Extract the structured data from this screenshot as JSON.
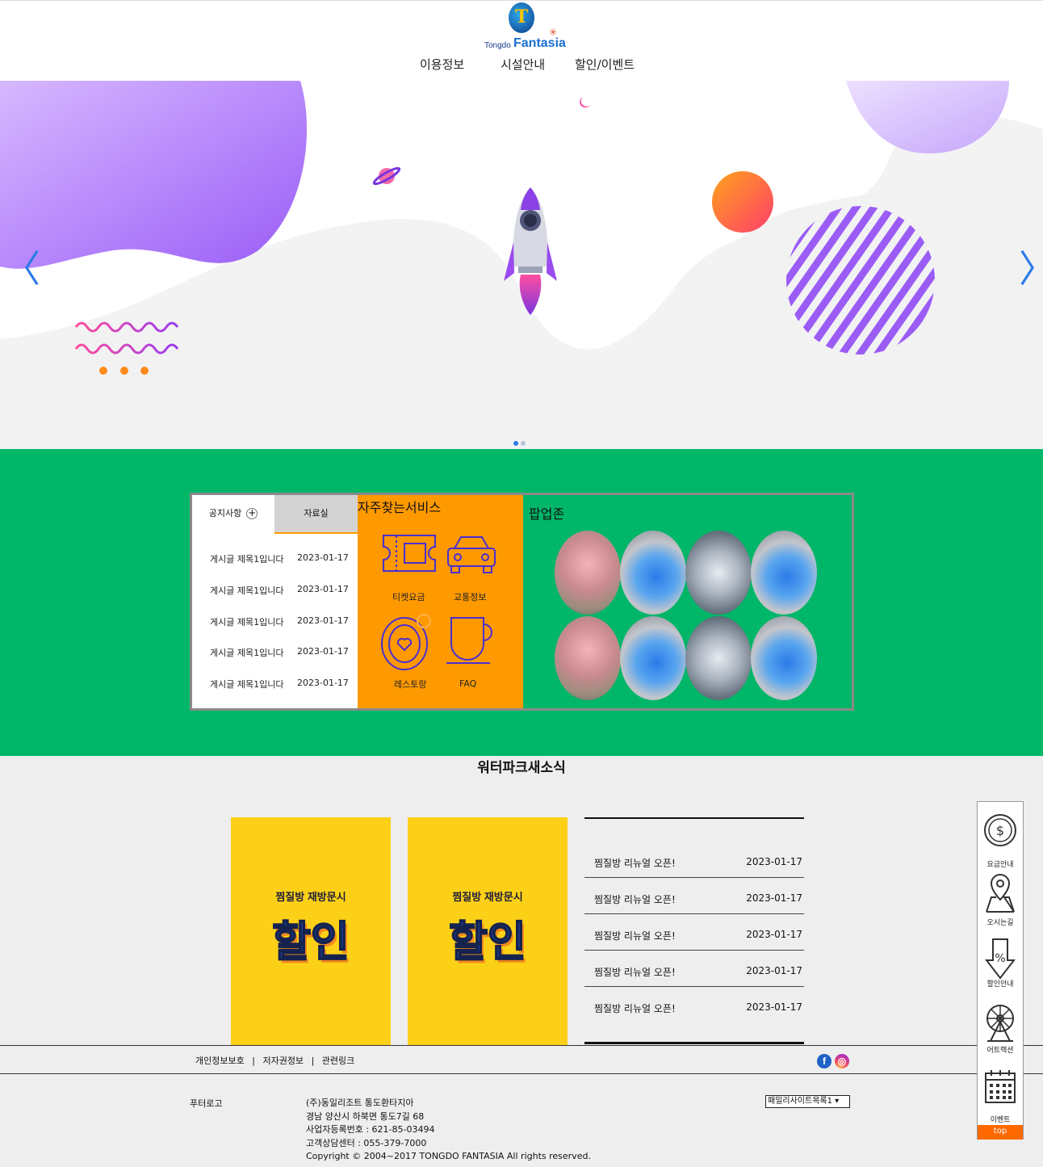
{
  "header": {
    "logo_small": "Tongdo",
    "logo_big": "Fantasia",
    "nav": [
      {
        "label": "이용정보"
      },
      {
        "label": "시설안내"
      },
      {
        "label": "할인/이벤트"
      }
    ]
  },
  "hero": {
    "prev_arrow": "〈",
    "next_arrow": "〉",
    "slide_count": 2,
    "active_slide": 1,
    "colors": {
      "purple": "#9b62f5",
      "orange": "#ff6a2b",
      "blue": "#2a7be8"
    }
  },
  "notice": {
    "tabs": [
      {
        "label": "공지사항"
      },
      {
        "label": "자료실"
      }
    ],
    "plus_icon": "+",
    "rows": [
      {
        "title": "게시글 제목1입니다",
        "date": "2023-01-17"
      },
      {
        "title": "게시글 제목1입니다",
        "date": "2023-01-17"
      },
      {
        "title": "게시글 제목1입니다",
        "date": "2023-01-17"
      },
      {
        "title": "게시글 제목1입니다",
        "date": "2023-01-17"
      },
      {
        "title": "게시글 제목1입니다",
        "date": "2023-01-17"
      }
    ]
  },
  "services": {
    "title": "자주찾는서비스",
    "items": [
      {
        "label": "티켓요금",
        "icon": "ticket-icon"
      },
      {
        "label": "교통정보",
        "icon": "car-icon"
      },
      {
        "label": "레스토랑",
        "icon": "plate-icon"
      },
      {
        "label": "FAQ",
        "icon": "cup-icon"
      }
    ]
  },
  "popup": {
    "title": "팝업존"
  },
  "news": {
    "title": "워터파크새소식",
    "banners": [
      {
        "sub": "찜질방 재방문시",
        "big": "할인"
      },
      {
        "sub": "찜질방 재방문시",
        "big": "할인"
      }
    ],
    "rows": [
      {
        "title": "찜질방 리뉴얼 오픈!",
        "date": "2023-01-17"
      },
      {
        "title": "찜질방 리뉴얼 오픈!",
        "date": "2023-01-17"
      },
      {
        "title": "찜질방 리뉴얼 오픈!",
        "date": "2023-01-17"
      },
      {
        "title": "찜질방 리뉴얼 오픈!",
        "date": "2023-01-17"
      },
      {
        "title": "찜질방 리뉴얼 오픈!",
        "date": "2023-01-17"
      }
    ]
  },
  "footer": {
    "links": [
      {
        "label": "개인정보보호"
      },
      {
        "label": "|"
      },
      {
        "label": "저자권정보"
      },
      {
        "label": "|"
      },
      {
        "label": "관련링크"
      }
    ],
    "logo_text": "푸터로고",
    "info": [
      "(주)동일리조트 통도환타지아",
      "경남 양산시 하북면 통도7길 68",
      "사업자등록번호 : 621-85-03494",
      "고객상담센터 : 055-379-7000",
      "Copyright © 2004~2017 TONGDO FANTASIA All rights reserved."
    ],
    "family_select": "패밀리사이트목록1 ▾"
  },
  "quick": {
    "items": [
      {
        "label": "요금안내",
        "icon": "dollar-coin-icon"
      },
      {
        "label": "오시는길",
        "icon": "map-pin-icon"
      },
      {
        "label": "할인안내",
        "icon": "percent-arrow-icon"
      },
      {
        "label": "어트랙션",
        "icon": "ferris-wheel-icon"
      },
      {
        "label": "이벤트",
        "icon": "calendar-icon"
      }
    ],
    "top_label": "top"
  }
}
